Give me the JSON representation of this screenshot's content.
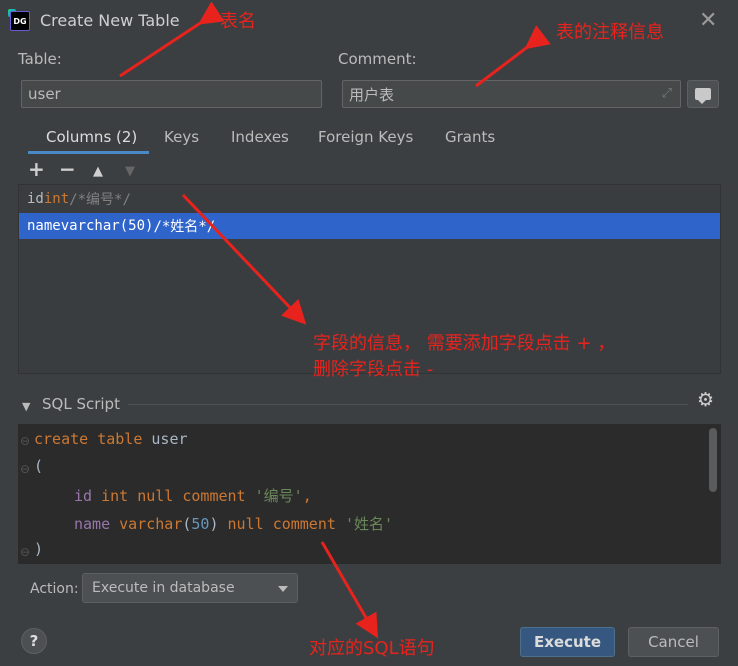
{
  "window": {
    "title": "Create New Table",
    "logo_text": "DG"
  },
  "table_field": {
    "label": "Table:",
    "value": "user"
  },
  "comment_field": {
    "label": "Comment:",
    "value": "用户表"
  },
  "tabs": [
    {
      "label": "Columns (2)",
      "active": true
    },
    {
      "label": "Keys",
      "active": false
    },
    {
      "label": "Indexes",
      "active": false
    },
    {
      "label": "Foreign Keys",
      "active": false
    },
    {
      "label": "Grants",
      "active": false
    }
  ],
  "columns_toolbar": {
    "add": "+",
    "remove": "−",
    "up": "▲",
    "down": "▼"
  },
  "columns": [
    {
      "name": "id",
      "type": "int",
      "comment": "/*编号*/",
      "selected": false
    },
    {
      "name": "name",
      "type": "varchar(50)",
      "comment": "/*姓名*/",
      "selected": true
    }
  ],
  "sql_section": {
    "title": "SQL Script",
    "arrow": "▼",
    "gear": "⚙"
  },
  "sql_lines": {
    "l1_kw": "create table",
    "l1_name": "user",
    "l2": "(",
    "l3_id": "id",
    "l3_type": "int",
    "l3_null": "null",
    "l3_comment_kw": "comment",
    "l3_comment": "'编号'",
    "l3_comma": ",",
    "l4_name": "name",
    "l4_type": "varchar",
    "l4_open": "(",
    "l4_num": "50",
    "l4_close": ")",
    "l4_null": "null",
    "l4_comment_kw": "comment",
    "l4_comment": "'姓名'",
    "l5": ")"
  },
  "action": {
    "label": "Action:",
    "selected": "Execute in database"
  },
  "buttons": {
    "help": "?",
    "execute": "Execute",
    "cancel": "Cancel"
  },
  "annotations": {
    "table_name": "表名",
    "comment_info": "表的注释信息",
    "columns_line1": "字段的信息， 需要添加字段点击 + ，",
    "columns_line2": "删除字段点击 -",
    "sql_statement": "对应的SQL语句"
  },
  "colors": {
    "background": "#3c3f41",
    "selection": "#2f65ca",
    "tab_underline": "#4a88c7",
    "annotation_red": "#e8231d",
    "primary_button": "#365880"
  }
}
